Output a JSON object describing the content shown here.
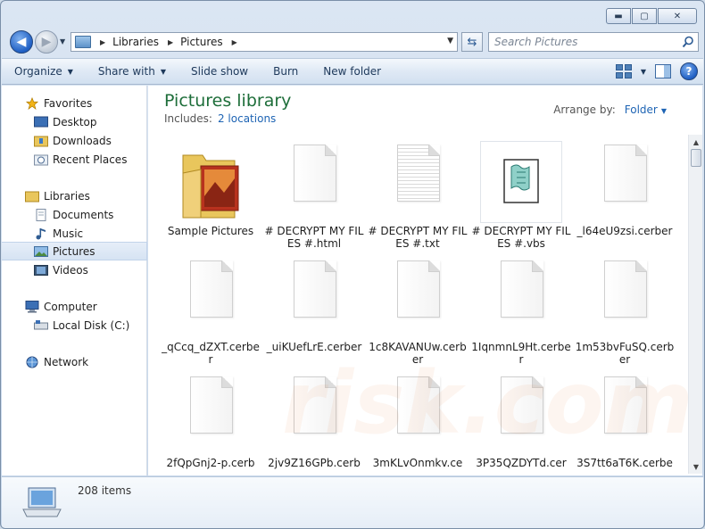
{
  "address": {
    "crumbs": [
      "Libraries",
      "Pictures"
    ]
  },
  "search": {
    "placeholder": "Search Pictures"
  },
  "commands": {
    "organize": "Organize",
    "share": "Share with",
    "slideshow": "Slide show",
    "burn": "Burn",
    "newfolder": "New folder"
  },
  "nav": {
    "favorites": "Favorites",
    "desktop": "Desktop",
    "downloads": "Downloads",
    "recent": "Recent Places",
    "libraries": "Libraries",
    "documents": "Documents",
    "music": "Music",
    "pictures": "Pictures",
    "videos": "Videos",
    "computer": "Computer",
    "localdisk": "Local Disk (C:)",
    "network": "Network"
  },
  "library": {
    "title": "Pictures library",
    "includes_label": "Includes:",
    "locations": "2 locations",
    "arrange_label": "Arrange by:",
    "arrange_value": "Folder"
  },
  "files": [
    "Sample Pictures",
    "# DECRYPT MY FILES #.html",
    "# DECRYPT MY FILES #.txt",
    "# DECRYPT MY FILES #.vbs",
    "_l64eU9zsi.cerber",
    "_qCcq_dZXT.cerber",
    "_uiKUefLrE.cerber",
    "1c8KAVANUw.cerber",
    "1IqnmnL9Ht.cerber",
    "1m53bvFuSQ.cerber",
    "2fQpGnj2-p.cerb",
    "2jv9Z16GPb.cerb",
    "3mKLvOnmkv.ce",
    "3P35QZDYTd.cer",
    "3S7tt6aT6K.cerbe"
  ],
  "status": {
    "count": "208 items"
  },
  "watermark": "risk.com"
}
